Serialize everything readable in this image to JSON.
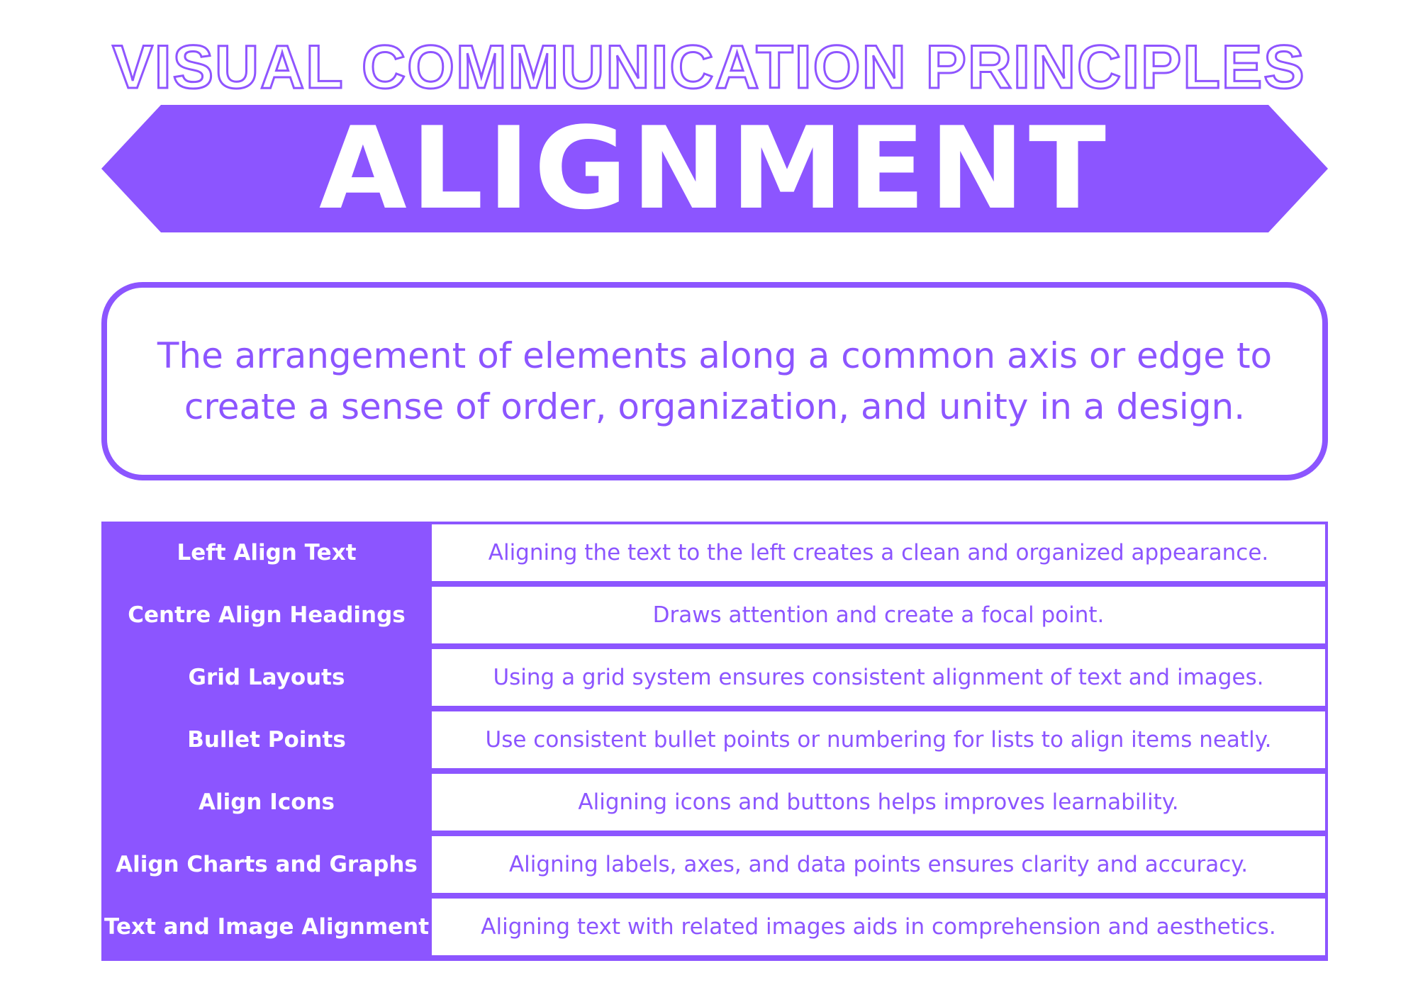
{
  "header": {
    "supertitle": "VISUAL COMMUNICATION PRINCIPLES",
    "title": "ALIGNMENT"
  },
  "definition": {
    "text": "The arrangement of elements along a common axis or edge to create a sense of order, organization, and unity in a design."
  },
  "principles": [
    {
      "term": "Left Align Text",
      "description": "Aligning the text to the left creates a clean and organized appearance."
    },
    {
      "term": "Centre Align Headings",
      "description": "Draws attention and create a focal point."
    },
    {
      "term": "Grid Layouts",
      "description": "Using a grid system ensures consistent alignment of text and images."
    },
    {
      "term": "Bullet Points",
      "description": "Use consistent bullet points or numbering for lists to align items neatly."
    },
    {
      "term": "Align Icons",
      "description": "Aligning icons and buttons helps improves learnability."
    },
    {
      "term": "Align Charts and Graphs",
      "description": "Aligning labels, axes, and data points ensures clarity and accuracy."
    },
    {
      "term": "Text and Image Alignment",
      "description": "Aligning text with related images aids in comprehension and aesthetics."
    }
  ],
  "colors": {
    "accent": "#8c55ff",
    "background": "#ffffff"
  }
}
